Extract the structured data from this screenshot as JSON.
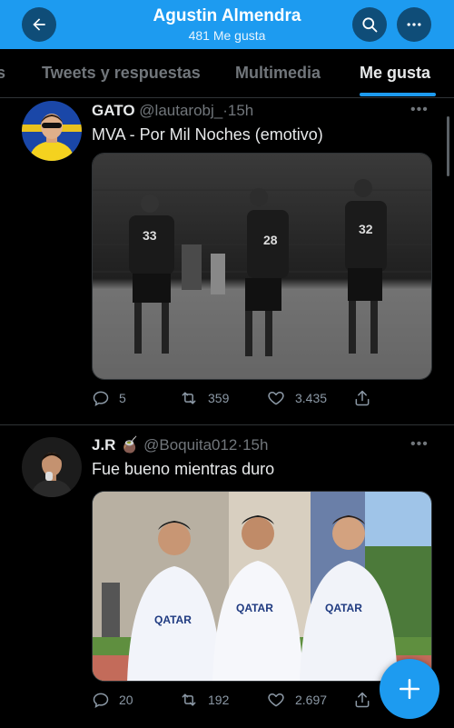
{
  "header": {
    "title": "Agustin Almendra",
    "subtitle": "481 Me gusta",
    "back_icon": "arrow-left-icon",
    "search_icon": "search-icon",
    "more_icon": "more-horizontal-icon",
    "background_color": "#1d9bf0"
  },
  "tabs": [
    {
      "label": "s",
      "active": false
    },
    {
      "label": "Tweets y respuestas",
      "active": false
    },
    {
      "label": "Multimedia",
      "active": false
    },
    {
      "label": "Me gusta",
      "active": true
    }
  ],
  "tweets": [
    {
      "name": "GATO",
      "handle": "@lautarobj_",
      "separator": "·",
      "time": "15h",
      "text": "MVA - Por Mil Noches (emotivo)",
      "image_caption": "Three football players in numbered jerseys on a pitch, black and white",
      "actions": {
        "replies": "5",
        "retweets": "359",
        "likes": "3.435"
      }
    },
    {
      "name": "J.R",
      "name_emoji": "🧉",
      "handle": "@Boquita012",
      "separator": "·",
      "time": "15h",
      "text": "Fue bueno mientras duro",
      "image_caption": "Three players in white Qatar Airways jerseys posing together",
      "actions": {
        "replies": "20",
        "retweets": "192",
        "likes": "2.697"
      }
    }
  ],
  "compose_button_icon": "plus-icon",
  "accent_color": "#1d9bf0"
}
